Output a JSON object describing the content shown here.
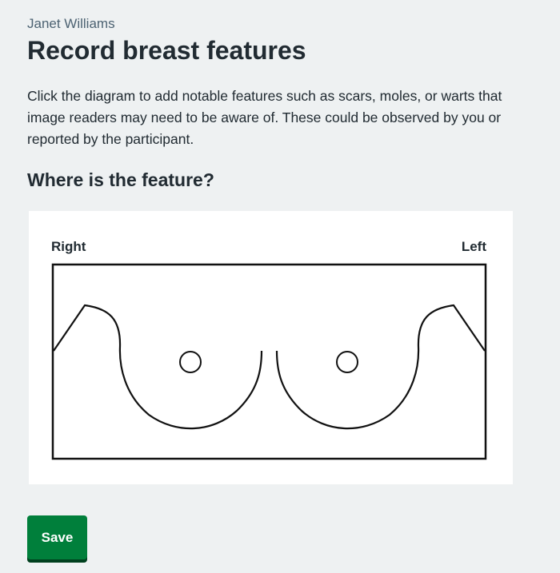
{
  "header": {
    "participant_name": "Janet Williams",
    "title": "Record breast features"
  },
  "main": {
    "description": "Click the diagram to add notable features such as scars, moles, or warts that image readers may need to be aware of. These could be observed by you or reported by the participant.",
    "question": "Where is the feature?"
  },
  "diagram": {
    "right_label": "Right",
    "left_label": "Left"
  },
  "actions": {
    "save_label": "Save"
  },
  "colors": {
    "background": "#eef1f2",
    "text": "#212b32",
    "secondary_text": "#4c6272",
    "button": "#007f3b",
    "button_shadow": "#00401e"
  }
}
